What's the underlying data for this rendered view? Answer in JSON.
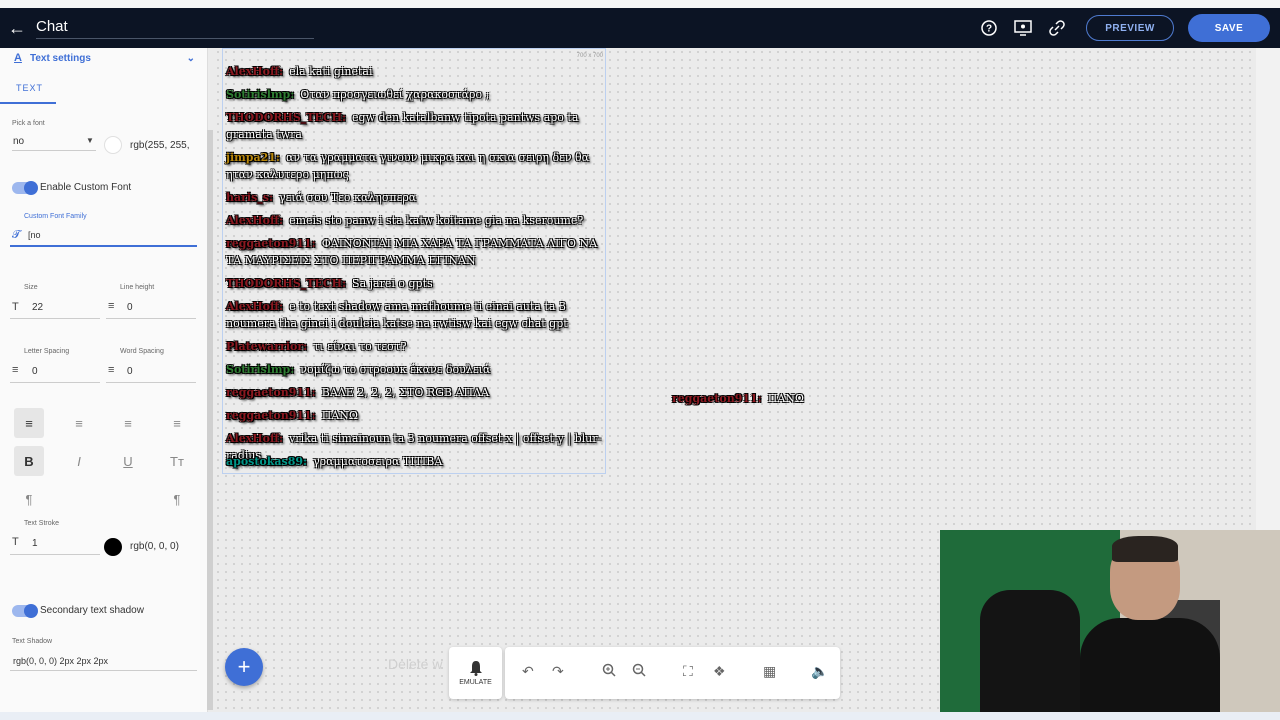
{
  "header": {
    "title": "Chat",
    "preview_label": "PREVIEW",
    "save_label": "SAVE"
  },
  "panel": {
    "section_title": "Text settings",
    "tab_label": "TEXT",
    "font_picker_label": "Pick a font",
    "font_value": "no",
    "color_value": "rgb(255, 255,",
    "enable_custom_font_label": "Enable Custom Font",
    "custom_font_family_label": "Custom Font Family",
    "custom_font_family_value": "[no",
    "size_label": "Size",
    "size_value": "22",
    "line_height_label": "Line height",
    "line_height_value": "0",
    "letter_spacing_label": "Letter Spacing",
    "letter_spacing_value": "0",
    "word_spacing_label": "Word Spacing",
    "word_spacing_value": "0",
    "text_stroke_label": "Text Stroke",
    "text_stroke_value": "1",
    "stroke_color_value": "rgb(0, 0, 0)",
    "secondary_shadow_label": "Secondary text shadow",
    "text_shadow_label": "Text Shadow",
    "text_shadow_value": "rgb(0, 0, 0) 2px 2px 2px"
  },
  "canvas": {
    "size_tag": "700 x 700",
    "messages": [
      {
        "user": "AlexHoff:",
        "text": "ela kati ginetai",
        "color": "red"
      },
      {
        "user": "Sotirislmp:",
        "text": "Οταν προσγειωθεί χαρακοστάρο ;",
        "color": "green"
      },
      {
        "user": "THODORHS_TECH:",
        "text": "egw den katalbanw tipota pantws apo ta gramata twra",
        "color": "red"
      },
      {
        "user": "jimpa21:",
        "text": "αν τα γραμματα γινουν μικρα και η σκια σειρη δεν θα ηταν καλυτερο μηπως",
        "color": "gold"
      },
      {
        "user": "haris_s:",
        "text": "γειά σου Τεο καλησπερα",
        "color": "red"
      },
      {
        "user": "AlexHoff:",
        "text": "emeis sto panw i sta katw koitame gia na kseroume?",
        "color": "red"
      },
      {
        "user": "reggaeton911:",
        "text": "ΦΑΙΝΟΝΤΑΙ ΜΙΑ ΧΑΡΑ ΤΑ ΓΡΑΜΜΑΤΑ ΛΙΓΟ ΝΑ ΤΑ ΜΑΥΡΙΣΕΙΣ ΣΤΟ ΠΕΡΙΓΡΑΜΜΑ ΕΓΙΝΑΝ",
        "color": "red"
      },
      {
        "user": "THODORHS_TECH:",
        "text": "Sa jarei o gpts",
        "color": "red"
      },
      {
        "user": "AlexHoff:",
        "text": "e to text shadow ama mathoume ti einai auta ta 3 noumera tha ginei i douleia katse na rwtisw kai egw chat gpt",
        "color": "red"
      },
      {
        "user": "Platewarrior:",
        "text": "τι είναι το τεστ?",
        "color": "red"
      },
      {
        "user": "Sotirislmp:",
        "text": "νομίζω το στροουκ έκανε δουλειά",
        "color": "green"
      },
      {
        "user": "reggaeton911:",
        "text": "ΒΑΛΕ 2, 2, 2, ΣΤΟ RGB ΑΠΛΑ",
        "color": "red"
      },
      {
        "user": "reggaeton911:",
        "text": "ΠΑΝΩ",
        "color": "red"
      },
      {
        "user": "AlexHoff:",
        "text": "vrika ti simainoun ta 3 noumera offset-x | offset-y | blur-radius",
        "color": "red"
      },
      {
        "user": "apostokas89:",
        "text": "γραμματοσειρα ΤΙΤΙΒΑ",
        "color": "teal"
      }
    ],
    "floating_user": "reggaeton911:",
    "floating_text": "ΠΑΝΩ",
    "ghost_text": "Delete w"
  },
  "toolbar": {
    "emulate_label": "EMULATE"
  },
  "colors": {
    "accent": "#3f6fd6",
    "topbar": "#0c1424"
  }
}
